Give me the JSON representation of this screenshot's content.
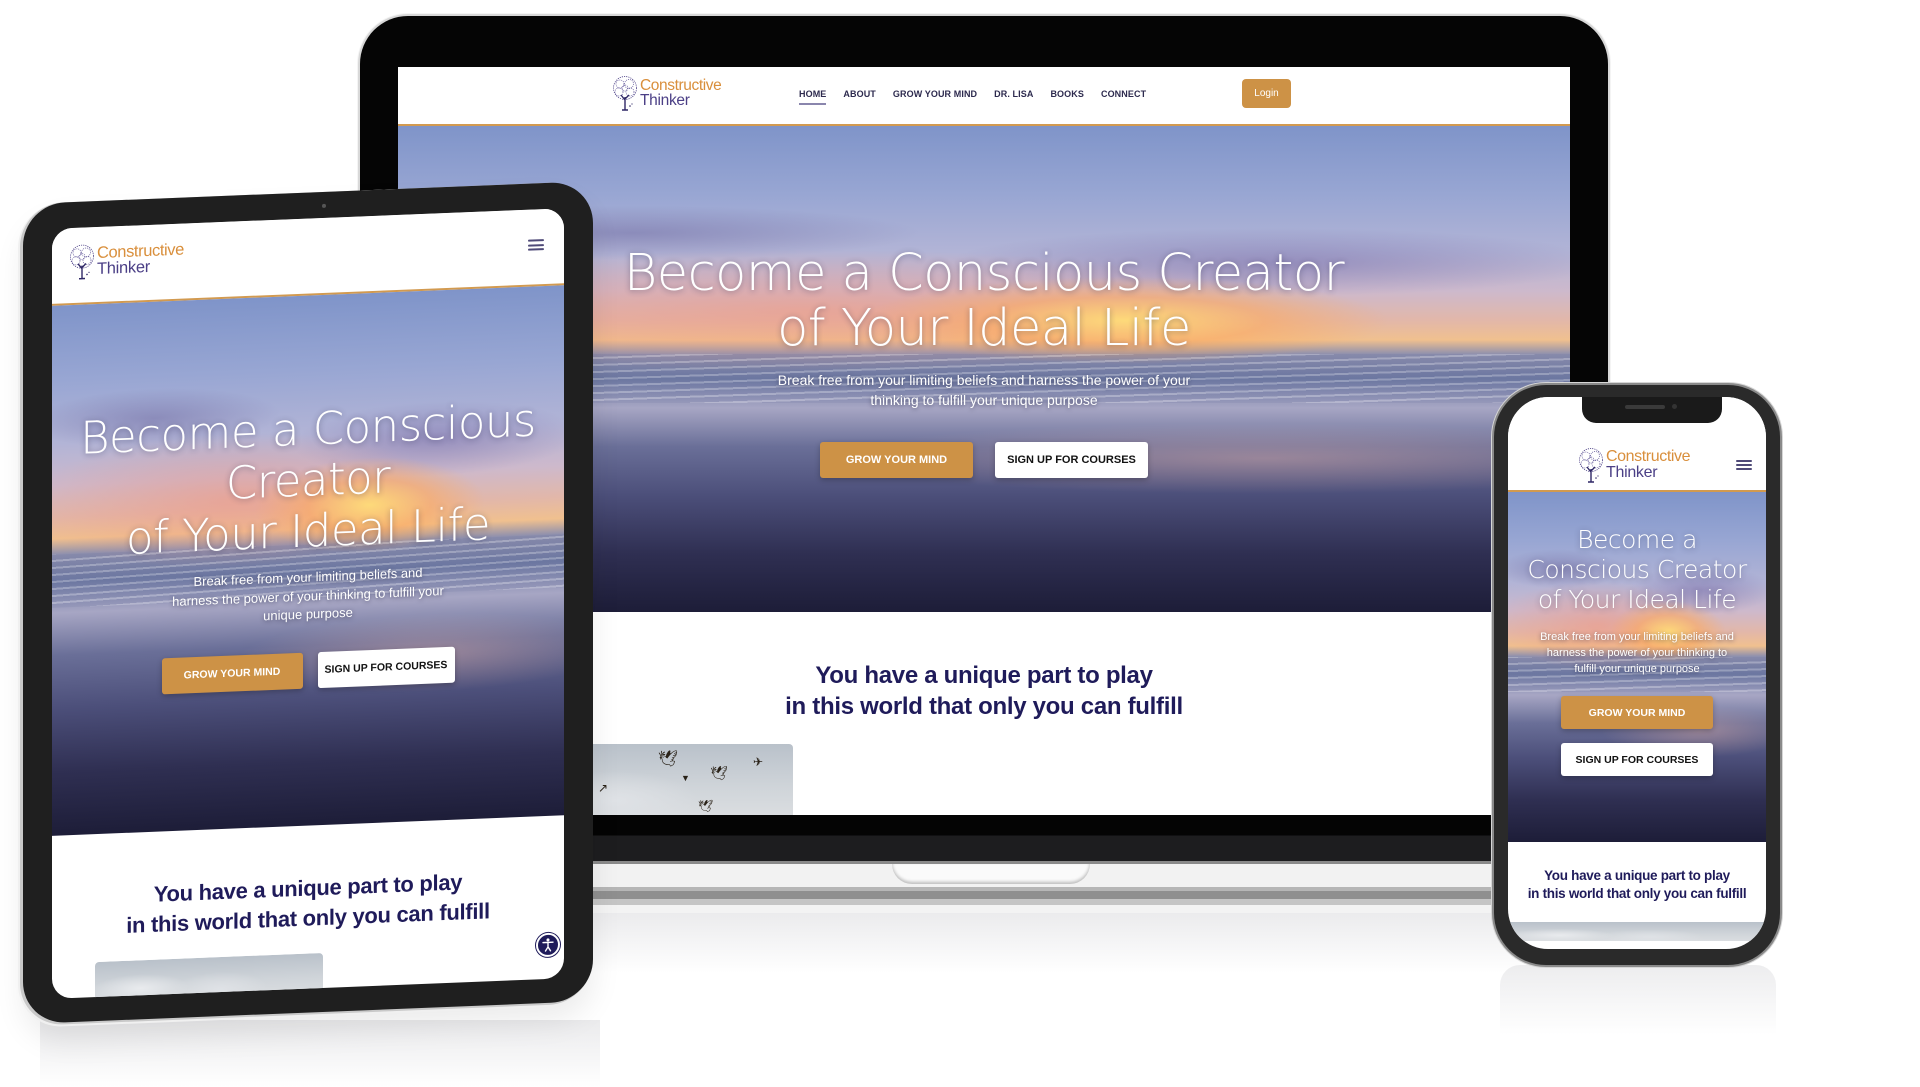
{
  "site": {
    "brand_line1": "Constructive",
    "brand_line2": "Thinker",
    "colors": {
      "accent_orange": "#cd9246",
      "brand_orange": "#d98f3c",
      "brand_purple": "#4b3f86",
      "headline_navy": "#1f1b5a"
    }
  },
  "desktop": {
    "nav": {
      "items": [
        {
          "label": "HOME",
          "active": true
        },
        {
          "label": "ABOUT",
          "active": false
        },
        {
          "label": "GROW YOUR MIND",
          "active": false
        },
        {
          "label": "DR. LISA",
          "active": false
        },
        {
          "label": "BOOKS",
          "active": false
        },
        {
          "label": "CONNECT",
          "active": false
        }
      ],
      "login_label": "Login"
    },
    "hero": {
      "title_line1": "Become a Conscious Creator",
      "title_line2": "of Your Ideal Life",
      "subtitle_line1": "Break free from your limiting beliefs and harness the power of your",
      "subtitle_line2": "thinking to fulfill your unique purpose",
      "primary_button": "GROW YOUR MIND",
      "secondary_button": "SIGN UP FOR COURSES"
    },
    "tagline_line1": "You have a unique part to play",
    "tagline_line2": "in this world that only you can fulfill"
  },
  "tablet": {
    "menu_icon": "hamburger-icon",
    "hero": {
      "title_line1": "Become a Conscious",
      "title_line2": "Creator",
      "title_line3": "of Your Ideal Life",
      "subtitle_line1": "Break free from your limiting beliefs and",
      "subtitle_line2": "harness the power of your thinking to fulfill your",
      "subtitle_line3": "unique purpose",
      "primary_button": "GROW YOUR MIND",
      "secondary_button": "SIGN UP FOR COURSES"
    },
    "tagline_line1": "You have a unique part to play",
    "tagline_line2": "in this world that only you can fulfill",
    "accessibility_icon": "accessibility-icon"
  },
  "mobile": {
    "menu_icon": "hamburger-icon",
    "hero": {
      "title_line1": "Become a",
      "title_line2": "Conscious Creator",
      "title_line3": "of Your Ideal Life",
      "subtitle_line1": "Break free from your limiting beliefs and",
      "subtitle_line2": "harness the power of your thinking to",
      "subtitle_line3": "fulfill your unique purpose",
      "primary_button": "GROW YOUR MIND",
      "secondary_button": "SIGN UP FOR COURSES"
    },
    "tagline_line1": "You have a unique part to play",
    "tagline_line2": "in this world that only you can fulfill"
  }
}
